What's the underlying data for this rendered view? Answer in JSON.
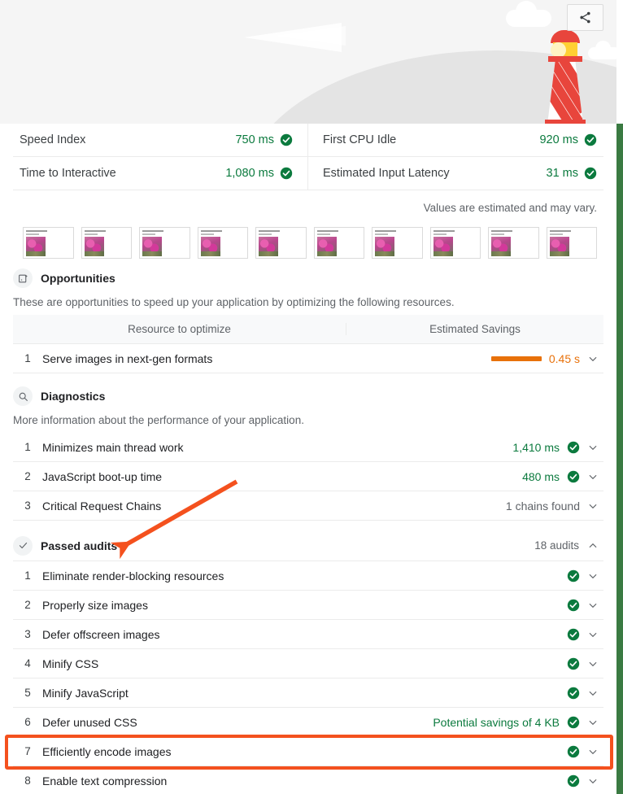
{
  "header": {
    "share_button_label": "share-icon",
    "graphic": "lighthouse"
  },
  "metrics": [
    {
      "label": "Speed Index",
      "value": "750 ms",
      "status": "pass",
      "column": "left"
    },
    {
      "label": "First CPU Idle",
      "value": "920 ms",
      "status": "pass",
      "column": "right"
    },
    {
      "label": "Time to Interactive",
      "value": "1,080 ms",
      "status": "pass",
      "column": "left"
    },
    {
      "label": "Estimated Input Latency",
      "value": "31 ms",
      "status": "pass",
      "column": "right"
    }
  ],
  "metrics_note": "Values are estimated and may vary.",
  "filmstrip": {
    "frame_count": 10
  },
  "opportunities": {
    "title": "Opportunities",
    "icon": "opportunities-icon",
    "description": "These are opportunities to speed up your application by optimizing the following resources.",
    "columns": {
      "resource": "Resource to optimize",
      "savings": "Estimated Savings"
    },
    "rows": [
      {
        "index": "1",
        "name": "Serve images in next-gen formats",
        "value": "0.45 s",
        "has_bar": true,
        "value_color": "#e8710a"
      }
    ]
  },
  "diagnostics": {
    "title": "Diagnostics",
    "icon": "search-icon",
    "description": "More information about the performance of your application.",
    "rows": [
      {
        "index": "1",
        "name": "Minimizes main thread work",
        "value": "1,410 ms",
        "status": "pass"
      },
      {
        "index": "2",
        "name": "JavaScript boot-up time",
        "value": "480 ms",
        "status": "pass"
      },
      {
        "index": "3",
        "name": "Critical Request Chains",
        "value": "1 chains found",
        "status": "none"
      }
    ]
  },
  "passed_audits": {
    "title": "Passed audits",
    "icon": "check-icon",
    "count_label": "18 audits",
    "expanded": true,
    "rows": [
      {
        "index": "1",
        "name": "Eliminate render-blocking resources",
        "value": "",
        "status": "pass"
      },
      {
        "index": "2",
        "name": "Properly size images",
        "value": "",
        "status": "pass"
      },
      {
        "index": "3",
        "name": "Defer offscreen images",
        "value": "",
        "status": "pass"
      },
      {
        "index": "4",
        "name": "Minify CSS",
        "value": "",
        "status": "pass"
      },
      {
        "index": "5",
        "name": "Minify JavaScript",
        "value": "",
        "status": "pass"
      },
      {
        "index": "6",
        "name": "Defer unused CSS",
        "value": "Potential savings of 4 KB",
        "status": "pass"
      },
      {
        "index": "7",
        "name": "Efficiently encode images",
        "value": "",
        "status": "pass",
        "highlighted": true
      },
      {
        "index": "8",
        "name": "Enable text compression",
        "value": "",
        "status": "pass"
      }
    ]
  },
  "annotations": {
    "arrow_color": "#f4511e",
    "highlight_color": "#f4511e",
    "arrow_target": "passed-audits-header"
  },
  "colors": {
    "pass_green": "#0b7a3e",
    "orange": "#e8710a",
    "annotation": "#f4511e",
    "text_primary": "#202124",
    "text_secondary": "#5f6368"
  }
}
